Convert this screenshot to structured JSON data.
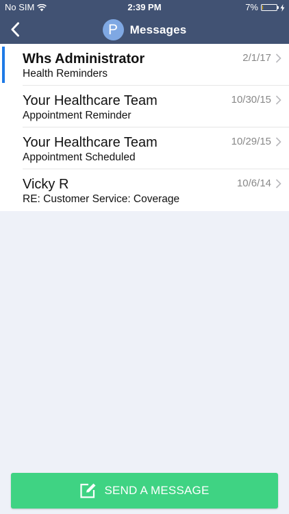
{
  "status_bar": {
    "carrier": "No SIM",
    "time": "2:39 PM",
    "battery_percent_label": "7%",
    "battery_level": 0.07,
    "wifi_icon": "wifi-icon",
    "charging_icon": "bolt-icon"
  },
  "nav": {
    "back_icon": "chevron-left-icon",
    "avatar_letter": "P",
    "title": "Messages"
  },
  "messages": [
    {
      "sender": "Whs Administrator",
      "subject": "Health Reminders",
      "date": "2/1/17",
      "unread": true
    },
    {
      "sender": "Your Healthcare Team",
      "subject": "Appointment Reminder",
      "date": "10/30/15",
      "unread": false
    },
    {
      "sender": "Your Healthcare Team",
      "subject": "Appointment Scheduled",
      "date": "10/29/15",
      "unread": false
    },
    {
      "sender": "Vicky R",
      "subject": "RE: Customer Service: Coverage",
      "date": "10/6/14",
      "unread": false
    }
  ],
  "send_button": {
    "label": "SEND A MESSAGE",
    "icon": "compose-icon"
  },
  "colors": {
    "header_bg": "#415273",
    "avatar_bg": "#7fa8e3",
    "unread_indicator": "#1e7ae6",
    "send_button_bg": "#3fd383",
    "list_bg": "#ffffff",
    "page_bg": "#eef1f8"
  }
}
